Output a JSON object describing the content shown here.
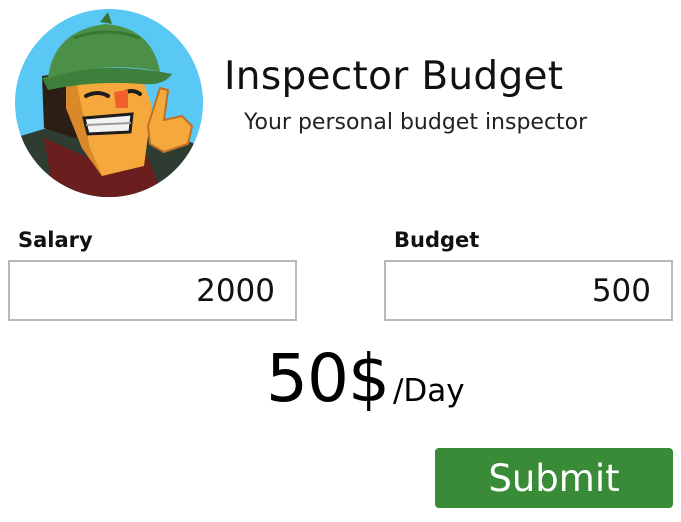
{
  "header": {
    "title": "Inspector Budget",
    "subtitle": "Your personal budget inspector",
    "avatar_icon": "detective-avatar-icon"
  },
  "form": {
    "salary": {
      "label": "Salary",
      "value": "2000"
    },
    "budget": {
      "label": "Budget",
      "value": "500"
    }
  },
  "result": {
    "amount": "50$",
    "unit": "/Day"
  },
  "actions": {
    "submit_label": "Submit"
  },
  "colors": {
    "submit_button": "#3a8b38",
    "input_border": "#b9b9b9",
    "avatar_background": "#5ac8f5"
  }
}
